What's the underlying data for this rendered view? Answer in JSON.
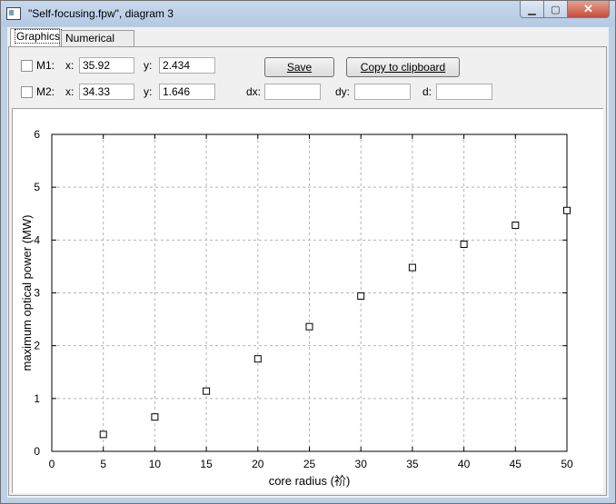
{
  "window": {
    "title": "\"Self-focusing.fpw\", diagram 3"
  },
  "tabs": [
    {
      "label": "Graphics"
    },
    {
      "label": "Numerical data"
    }
  ],
  "markers": {
    "m1": {
      "label": "M1:",
      "x_label": "x:",
      "x": "35.92",
      "y_label": "y:",
      "y": "2.434"
    },
    "m2": {
      "label": "M2:",
      "x_label": "x:",
      "x": "34.33",
      "y_label": "y:",
      "y": "1.646"
    }
  },
  "deltas": {
    "dx_label": "dx:",
    "dy_label": "dy:",
    "d_label": "d:",
    "dx": "",
    "dy": "",
    "d": ""
  },
  "buttons": {
    "save": "Save",
    "copy": "Copy to clipboard"
  },
  "chart_data": {
    "type": "scatter",
    "xlabel": "core radius (祄)",
    "ylabel": "maximum optical power (MW)",
    "xlim": [
      0,
      50
    ],
    "ylim": [
      0,
      6
    ],
    "xticks": [
      "0",
      "5",
      "10",
      "15",
      "20",
      "25",
      "30",
      "35",
      "40",
      "45",
      "50"
    ],
    "yticks": [
      "0",
      "1",
      "2",
      "3",
      "4",
      "5",
      "6"
    ],
    "grid": true,
    "x": [
      5,
      10,
      15,
      20,
      25,
      30,
      35,
      40,
      45,
      50
    ],
    "y": [
      0.32,
      0.65,
      1.14,
      1.75,
      2.36,
      2.94,
      3.48,
      3.92,
      4.28,
      4.56
    ]
  }
}
